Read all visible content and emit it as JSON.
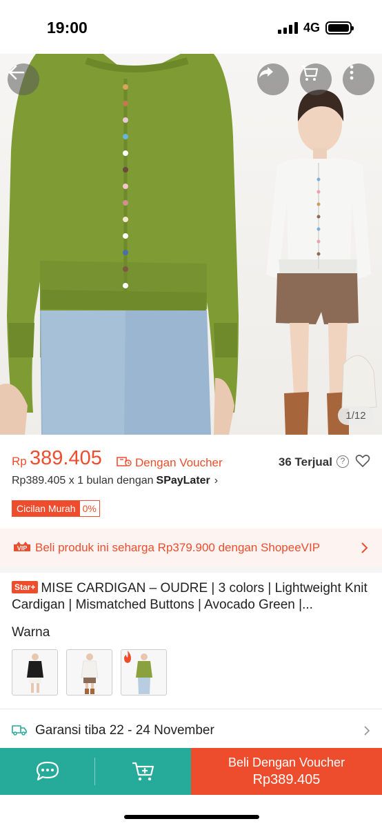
{
  "status_bar": {
    "time": "19:00",
    "network": "4G"
  },
  "gallery": {
    "counter": "1/12"
  },
  "price": {
    "currency": "Rp",
    "amount": "389.405",
    "voucher_label": "Dengan Voucher",
    "sold": "36 Terjual",
    "help_glyph": "?"
  },
  "paylater": {
    "text": "Rp389.405 x 1 bulan dengan",
    "brand": "SPayLater",
    "chevron": "›"
  },
  "installment": {
    "label": "Cicilan Murah",
    "rate": "0%"
  },
  "vip": {
    "badge": "VIP",
    "text_before": "Beli produk ini seharga ",
    "price": "Rp379.900",
    "text_after": " dengan ShopeeVIP"
  },
  "product": {
    "badge": "Star+",
    "title": "MISE CARDIGAN – OUDRE | 3 colors | Lightweight Knit Cardigan | Mismatched Buttons | Avocado Green |..."
  },
  "variants": {
    "label": "Warna",
    "colors": {
      "black": "#1d1d1d",
      "white": "#f2f1ee",
      "green": "#8aa13f",
      "accent": "#ee4d2d"
    }
  },
  "shipping": {
    "text": "Garansi tiba 22 - 24 November"
  },
  "actions": {
    "buy_label": "Beli Dengan Voucher",
    "buy_price": "Rp389.405"
  },
  "colors": {
    "primary": "#ee4d2d",
    "teal": "#26aa99"
  },
  "icons": [
    "back-arrow-icon",
    "share-icon",
    "cart-icon",
    "more-icon",
    "voucher-icon",
    "help-icon",
    "heart-icon",
    "chevron-right-icon",
    "truck-icon",
    "chat-icon",
    "add-to-cart-icon",
    "hot-icon"
  ]
}
